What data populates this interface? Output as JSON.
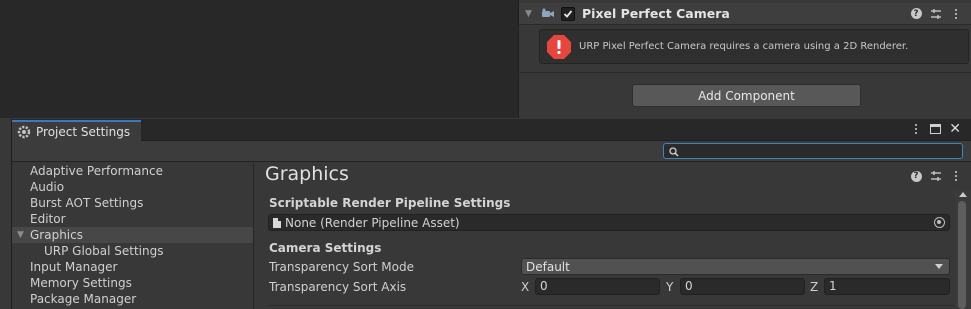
{
  "inspector": {
    "component": {
      "title": "Pixel Perfect Camera",
      "enabled": true,
      "icons": [
        "help-icon",
        "presets-icon",
        "more-icon"
      ]
    },
    "helpbox": {
      "type": "error",
      "message": "URP Pixel Perfect Camera requires a camera using a 2D Renderer."
    },
    "add_component_label": "Add Component"
  },
  "project_settings": {
    "tab_title": "Project Settings",
    "window_icons": [
      "more-icon",
      "maximize-icon",
      "close-icon"
    ],
    "search": {
      "value": "",
      "placeholder": ""
    },
    "sidebar": {
      "items": [
        {
          "label": "Adaptive Performance",
          "selected": false,
          "indent": 0
        },
        {
          "label": "Audio",
          "selected": false,
          "indent": 0
        },
        {
          "label": "Burst AOT Settings",
          "selected": false,
          "indent": 0
        },
        {
          "label": "Editor",
          "selected": false,
          "indent": 0
        },
        {
          "label": "Graphics",
          "selected": true,
          "indent": 0,
          "expanded": true
        },
        {
          "label": "URP Global Settings",
          "selected": false,
          "indent": 1
        },
        {
          "label": "Input Manager",
          "selected": false,
          "indent": 0
        },
        {
          "label": "Memory Settings",
          "selected": false,
          "indent": 0
        },
        {
          "label": "Package Manager",
          "selected": false,
          "indent": 0
        }
      ]
    },
    "main": {
      "title": "Graphics",
      "srp_section": {
        "heading": "Scriptable Render Pipeline Settings",
        "field_value": "None (Render Pipeline Asset)"
      },
      "camera_section": {
        "heading": "Camera Settings",
        "sort_mode_label": "Transparency Sort Mode",
        "sort_mode_value": "Default",
        "sort_axis_label": "Transparency Sort Axis",
        "sort_axis": {
          "x_label": "X",
          "x_value": "0",
          "y_label": "Y",
          "y_value": "0",
          "z_label": "Z",
          "z_value": "1"
        }
      }
    }
  },
  "colors": {
    "accent": "#3a79bb",
    "error": "#e5463d"
  }
}
